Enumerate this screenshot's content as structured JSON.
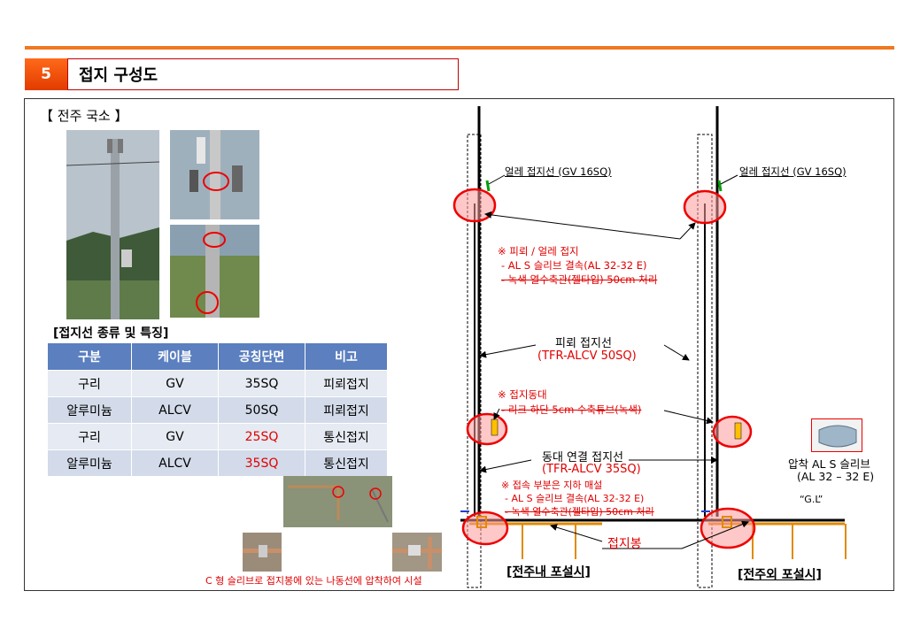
{
  "header": {
    "number": "5",
    "title": "접지 구성도"
  },
  "left": {
    "pole_title": "【 전주 국소 】",
    "table_title": "[접지선 종류 및 특징]",
    "table": {
      "headers": [
        "구분",
        "케이블",
        "공칭단면",
        "비고"
      ],
      "rows": [
        [
          "구리",
          "GV",
          "35SQ",
          "피뢰접지"
        ],
        [
          "알루미늄",
          "ALCV",
          "50SQ",
          "피뢰접지"
        ],
        [
          "구리",
          "GV",
          "25SQ",
          "통신접지"
        ],
        [
          "알루미늄",
          "ALCV",
          "35SQ",
          "통신접지"
        ]
      ],
      "red_cells": [
        "2-2",
        "3-2"
      ]
    },
    "caption": "C 형 슬리브로 접지봉에 있는 나동선에 압착하여 시설"
  },
  "diagram": {
    "left_label_top": "얼레 접지선 (GV 16SQ)",
    "right_label_top": "얼레 접지선 (GV 16SQ)",
    "note1_title": "※ 피뢰 / 얼레 접지",
    "note1_line1": "- AL S 슬리브 결속(AL 32-32 E)",
    "note1_line2": "- 녹색 열수축관(젤타입) 50cm 처리",
    "lightning_label": "피뢰 접지선",
    "lightning_spec": "(TFR-ALCV 50SQ)",
    "note2_title": "※ 접지동대",
    "note2_line1": "- 리크 하단 5cm 수축튜브(녹색)",
    "bond_label": "동대 연결 접지선",
    "bond_spec": "(TFR-ALCV 35SQ)",
    "note3_title": "※ 접속 부분은 지하 매설",
    "note3_line1": "- AL S 슬리브 결속(AL 32-32 E)",
    "note3_line2": "- 녹색 열수축관(젤타입) 50cm 처리",
    "rod_label": "접지봉",
    "sleeve_label": "압착 AL S 슬리브",
    "sleeve_spec": "(AL 32 – 32 E)",
    "gl_label": "“G.L”",
    "inner_caption": "[전주내 포설시]",
    "outer_caption": "[전주외 포설시]"
  }
}
